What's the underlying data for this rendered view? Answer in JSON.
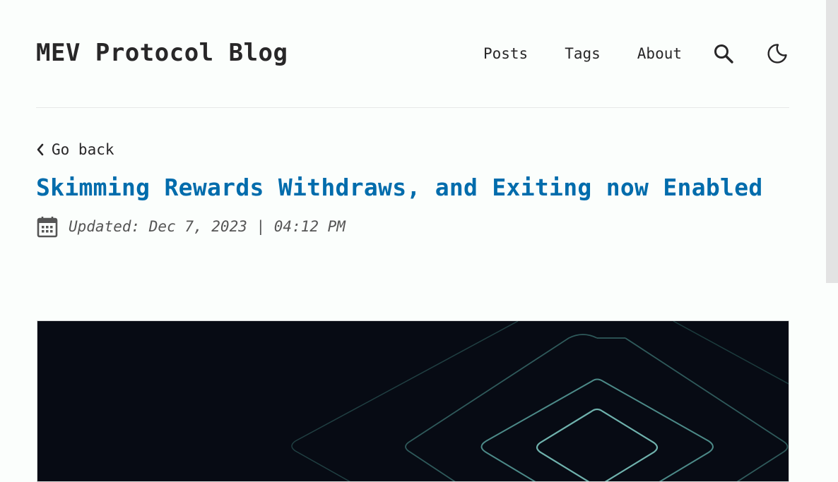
{
  "site": {
    "title": "MEV Protocol Blog"
  },
  "nav": {
    "items": [
      {
        "label": "Posts"
      },
      {
        "label": "Tags"
      },
      {
        "label": "About"
      }
    ],
    "search_icon": "search-icon",
    "theme_icon": "moon-icon"
  },
  "post": {
    "go_back": "Go back",
    "title": "Skimming Rewards Withdraws, and Exiting now Enabled",
    "updated": "Updated: Dec 7, 2023 | 04:12 PM",
    "calendar_icon": "calendar-icon",
    "hero_image": "dark background with concentric rounded diamond outlines in teal"
  },
  "colors": {
    "background": "#fbfefc",
    "text": "#282728",
    "accent": "#006cac",
    "hero_bg": "#070b14",
    "hero_lines": "#5a9f9a"
  }
}
